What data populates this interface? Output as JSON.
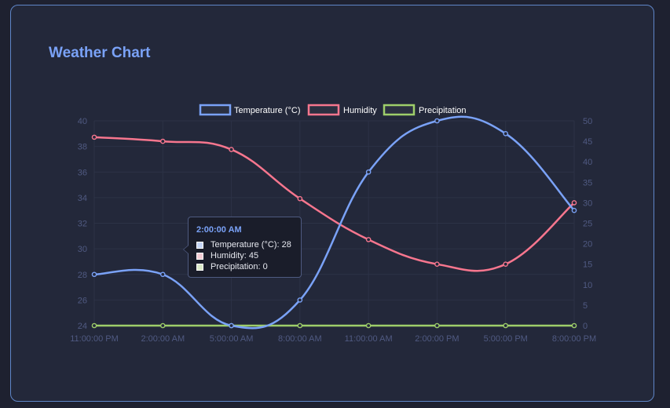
{
  "title": "Weather Chart",
  "colors": {
    "temperature": "#7aa2f7",
    "humidity": "#f7768e",
    "precipitation": "#9ece6a",
    "tick": "#505a82",
    "grid": "#2c3246",
    "legend_text": "#ffffff"
  },
  "chart_data": {
    "type": "line",
    "categories": [
      "11:00:00 PM",
      "2:00:00 AM",
      "5:00:00 AM",
      "8:00:00 AM",
      "11:00:00 AM",
      "2:00:00 PM",
      "5:00:00 PM",
      "8:00:00 PM"
    ],
    "series": [
      {
        "name": "Temperature (°C)",
        "axis": "left",
        "values": [
          28,
          28,
          24,
          26,
          36,
          40,
          39,
          33
        ]
      },
      {
        "name": "Humidity",
        "axis": "right",
        "values": [
          46,
          45,
          43,
          31,
          21,
          15,
          15,
          30
        ]
      },
      {
        "name": "Precipitation",
        "axis": "right",
        "values": [
          0,
          0,
          0,
          0,
          0,
          0,
          0,
          0
        ]
      }
    ],
    "y_left": {
      "min": 24,
      "max": 40,
      "ticks": [
        "40",
        "38",
        "36",
        "34",
        "32",
        "30",
        "28",
        "26",
        "24"
      ]
    },
    "y_right": {
      "min": 0,
      "max": 50,
      "ticks": [
        "50",
        "45",
        "40",
        "35",
        "30",
        "25",
        "20",
        "15",
        "10",
        "5",
        "0"
      ]
    },
    "legend": "top-center",
    "grid": true
  },
  "tooltip": {
    "title": "2:00:00 AM",
    "rows": [
      "Temperature (°C): 28",
      "Humidity: 45",
      "Precipitation: 0"
    ]
  }
}
